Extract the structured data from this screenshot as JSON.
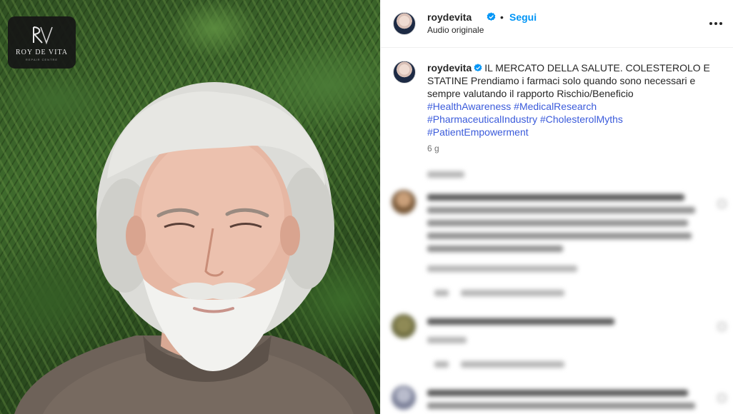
{
  "media": {
    "logo_text": "ROY DE VITA",
    "logo_subtitle": "REPAIR CENTRE"
  },
  "header": {
    "username": "roydevita",
    "separator": "•",
    "follow_label": "Segui",
    "audio_label": "Audio originale",
    "more_icon": "more-horizontal-icon"
  },
  "caption": {
    "username": "roydevita",
    "text": "IL MERCATO DELLA SALUTE. COLESTEROLO E STATINE Prendiamo i farmaci solo quando sono necessari e sempre valutando il rapporto Rischio/Beneficio",
    "hashtags": [
      "#HealthAwareness",
      "#MedicalResearch",
      "#PharmaceuticalIndustry",
      "#CholesterolMyths",
      "#PatientEmpowerment"
    ],
    "time": "6 g"
  },
  "colors": {
    "accent": "#0095f6",
    "verified": "#0095f6",
    "hashtag": "#3b5bdb",
    "text": "#262626",
    "secondary": "#737373"
  }
}
